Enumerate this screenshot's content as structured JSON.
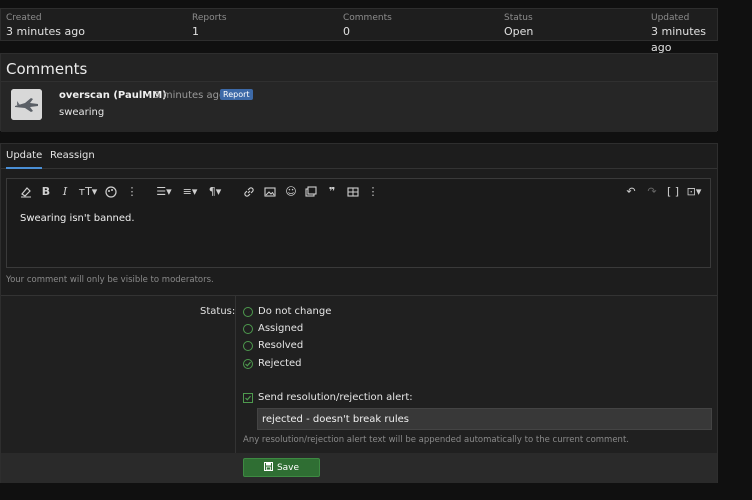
{
  "stats": [
    {
      "label": "Created",
      "value": "3 minutes ago"
    },
    {
      "label": "Reports",
      "value": "1"
    },
    {
      "label": "Comments",
      "value": "0"
    },
    {
      "label": "Status",
      "value": "Open"
    },
    {
      "label": "Updated",
      "value": "3 minutes ago"
    }
  ],
  "comments": {
    "title": "Comments",
    "item": {
      "author": "overscan (PaulMM)",
      "meta": "· 3 minutes ago ·",
      "badge": "Report",
      "text": "swearing"
    }
  },
  "tabs": [
    {
      "label": "Update",
      "active": true
    },
    {
      "label": "Reassign",
      "active": false
    }
  ],
  "editor": {
    "content": "Swearing isn't banned.",
    "hint": "Your comment will only be visible to moderators."
  },
  "form": {
    "status_label": "Status:",
    "options": [
      {
        "label": "Do not change"
      },
      {
        "label": "Assigned"
      },
      {
        "label": "Resolved"
      },
      {
        "label": "Rejected",
        "checked": true
      }
    ],
    "alert_label": "Send resolution/rejection alert:",
    "alert_value": "rejected - doesn't break rules",
    "alert_hint": "Any resolution/rejection alert text will be appended automatically to the current comment.",
    "save_label": "Save"
  },
  "colors": {
    "accent": "#4a8fd6",
    "success": "#2f6e33",
    "badge": "#3d6aa8"
  }
}
